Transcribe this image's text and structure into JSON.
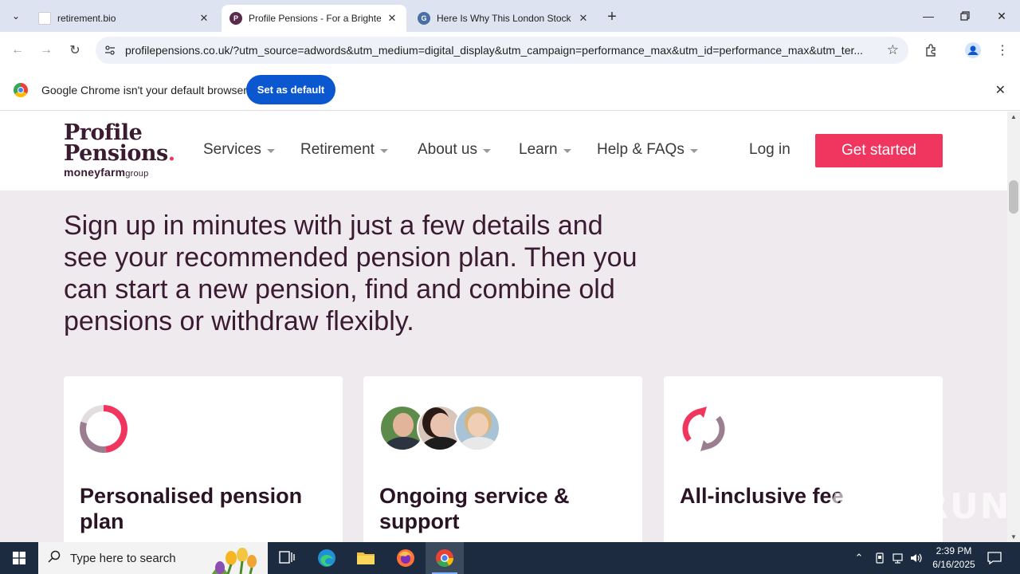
{
  "browser": {
    "tabs": [
      {
        "title": "retirement.bio",
        "favicon": "blank-page-icon",
        "active": false
      },
      {
        "title": "Profile Pensions - For a Brighter",
        "favicon": "profile-pensions-favicon",
        "active": true
      },
      {
        "title": "Here Is Why This London Stock",
        "favicon": "gg-favicon",
        "active": false
      }
    ],
    "url": "profilepensions.co.uk/?utm_source=adwords&utm_medium=digital_display&utm_campaign=performance_max&utm_id=performance_max&utm_ter...",
    "infobar": {
      "message": "Google Chrome isn't your default browser",
      "button": "Set as default"
    }
  },
  "site": {
    "logo": {
      "line1": "Profile",
      "line2": "Pensions",
      "dot": ".",
      "sub": "moneyfarm",
      "sub_small": "group"
    },
    "nav": [
      "Services",
      "Retirement",
      "About us",
      "Learn",
      "Help & FAQs"
    ],
    "login": "Log in",
    "cta": "Get started",
    "hero_text": "Sign up in minutes with just a few details and see your recommended pension plan. Then you can start a new pension, find and combine old pensions or withdraw flexibly.",
    "cards": [
      {
        "title": "Personalised pension plan",
        "icon": "donut-chart-icon"
      },
      {
        "title": "Ongoing service & support",
        "icon": "advisor-avatars"
      },
      {
        "title": "All-inclusive fee",
        "icon": "refresh-cycle-icon"
      }
    ],
    "watermark": "ANY.RUN"
  },
  "taskbar": {
    "search_placeholder": "Type here to search",
    "time": "2:39 PM",
    "date": "6/16/2025"
  },
  "colors": {
    "brand_pink": "#f0355e",
    "brand_plum": "#3a1b31",
    "page_bg": "#efeaee",
    "chrome_blue": "#0b57d0"
  }
}
